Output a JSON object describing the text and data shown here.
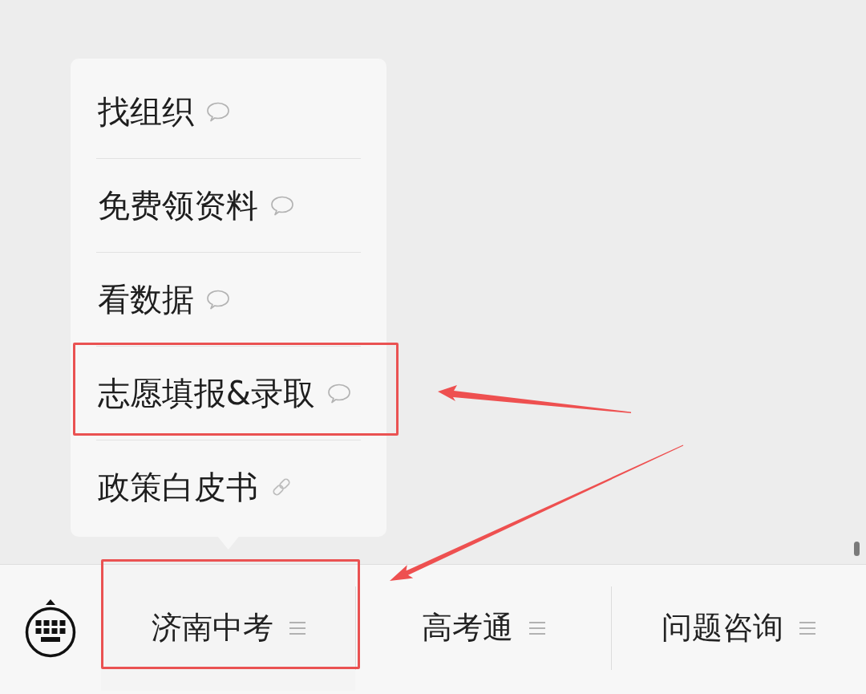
{
  "popup_menu": {
    "items": [
      {
        "label": "找组织",
        "kind": "chat",
        "annotated": false
      },
      {
        "label": "免费领资料",
        "kind": "chat",
        "annotated": false
      },
      {
        "label": "看数据",
        "kind": "chat",
        "annotated": false
      },
      {
        "label": "志愿填报&录取",
        "kind": "chat",
        "annotated": true
      },
      {
        "label": "政策白皮书",
        "kind": "link",
        "annotated": false
      }
    ]
  },
  "bottom_bar": {
    "tabs": [
      {
        "label": "济南中考",
        "expanded": true,
        "annotated": true
      },
      {
        "label": "高考通",
        "expanded": false,
        "annotated": false
      },
      {
        "label": "问题咨询",
        "expanded": false,
        "annotated": false
      }
    ]
  }
}
